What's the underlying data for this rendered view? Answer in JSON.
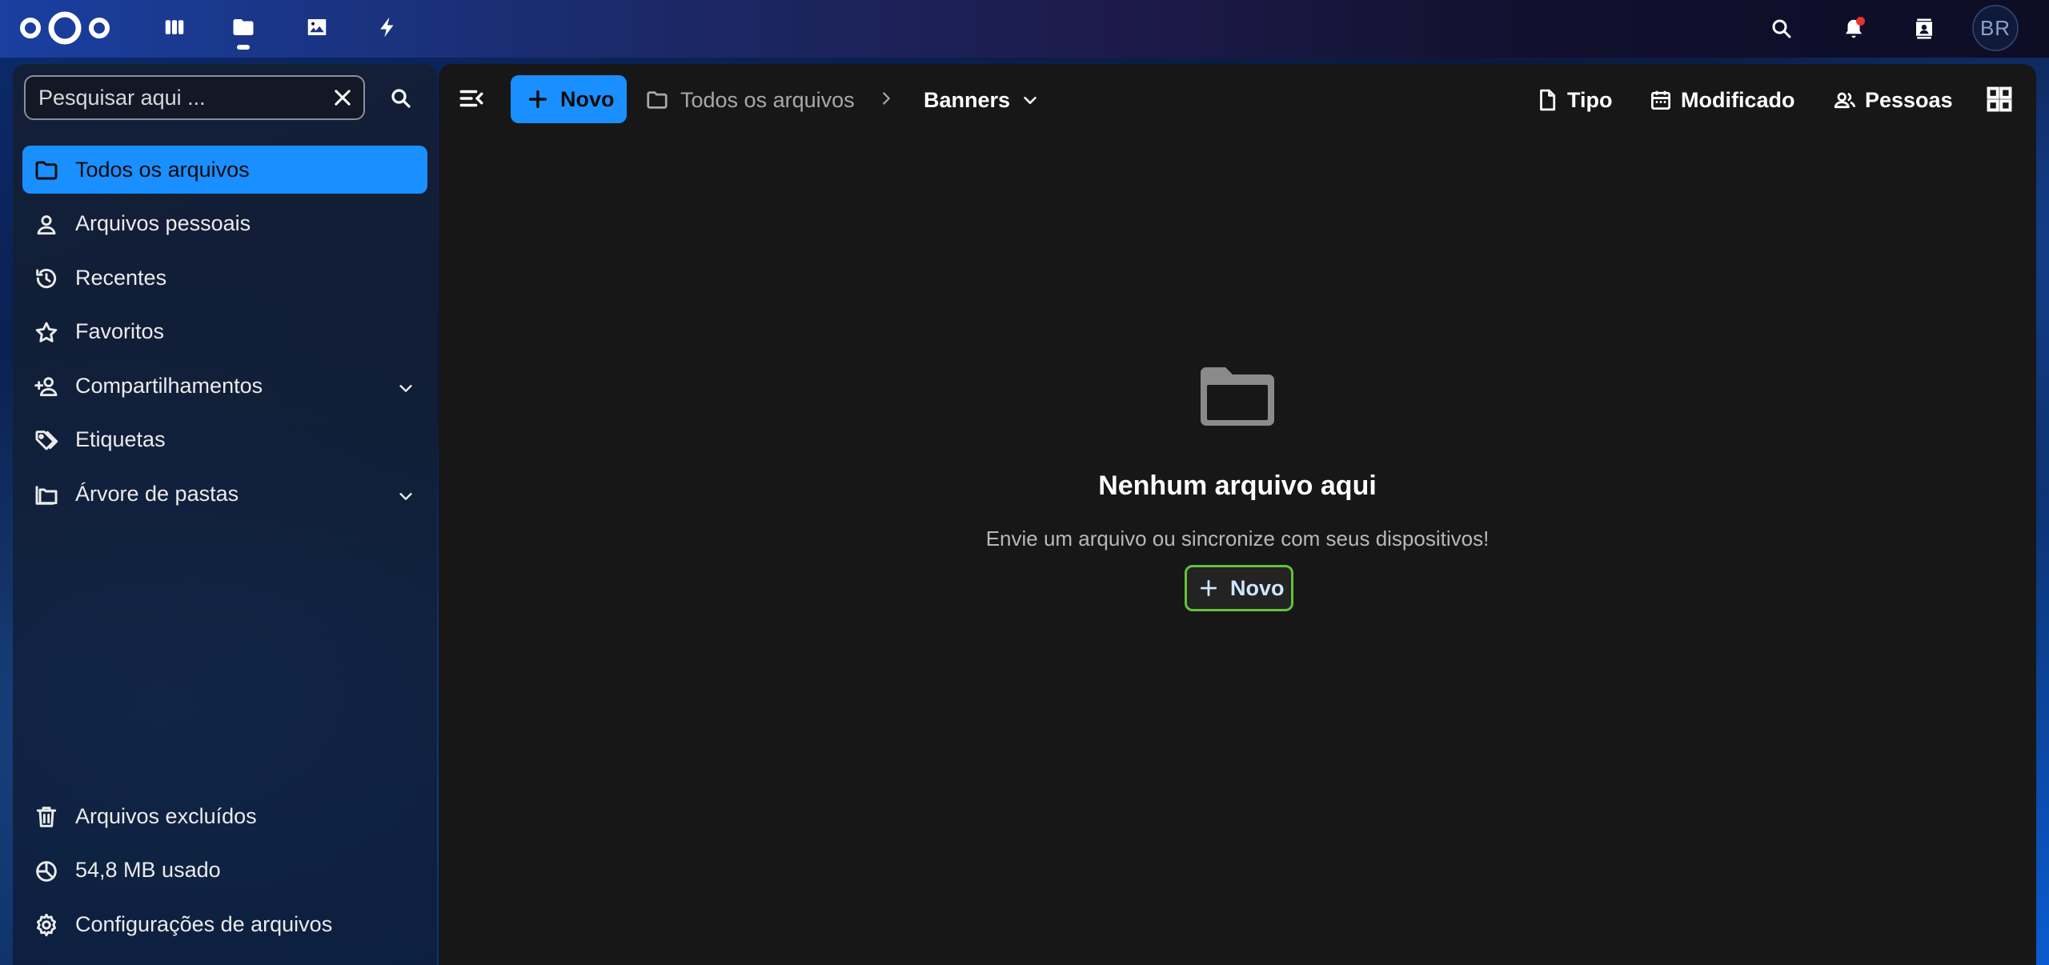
{
  "header": {
    "apps": [
      {
        "name": "dashboard",
        "icon": "dashboard-icon"
      },
      {
        "name": "files",
        "icon": "folder-icon",
        "active": true
      },
      {
        "name": "photos",
        "icon": "image-icon"
      },
      {
        "name": "activity",
        "icon": "bolt-icon"
      }
    ],
    "right": [
      "search-icon",
      "bell-icon",
      "contacts-icon"
    ],
    "avatar_initials": "BR",
    "notification_color": "#e9322d"
  },
  "sidebar": {
    "search_placeholder": "Pesquisar aqui ...",
    "items": [
      {
        "label": "Todos os arquivos",
        "icon": "folder-icon",
        "active": true
      },
      {
        "label": "Arquivos pessoais",
        "icon": "user-icon"
      },
      {
        "label": "Recentes",
        "icon": "history-icon"
      },
      {
        "label": "Favoritos",
        "icon": "star-icon"
      },
      {
        "label": "Compartilhamentos",
        "icon": "share-user-icon",
        "expandable": true
      },
      {
        "label": "Etiquetas",
        "icon": "tag-icon"
      },
      {
        "label": "Árvore de pastas",
        "icon": "folder-tree-icon",
        "expandable": true
      }
    ],
    "bottom": [
      {
        "label": "Arquivos excluídos",
        "icon": "trash-icon"
      },
      {
        "label": "54,8 MB usado",
        "icon": "pie-chart-icon"
      },
      {
        "label": "Configurações de arquivos",
        "icon": "gear-icon"
      }
    ]
  },
  "toolbar": {
    "new_label": "Novo",
    "breadcrumb_root": "Todos os arquivos",
    "breadcrumb_current": "Banners",
    "filters": {
      "type": "Tipo",
      "modified": "Modificado",
      "people": "Pessoas"
    }
  },
  "empty_state": {
    "title": "Nenhum arquivo aqui",
    "description": "Envie um arquivo ou sincronize com seus dispositivos!",
    "new_label": "Novo"
  },
  "colors": {
    "accent": "#1a8fff",
    "focus_outline": "#62c23b",
    "main_bg": "#171717"
  }
}
